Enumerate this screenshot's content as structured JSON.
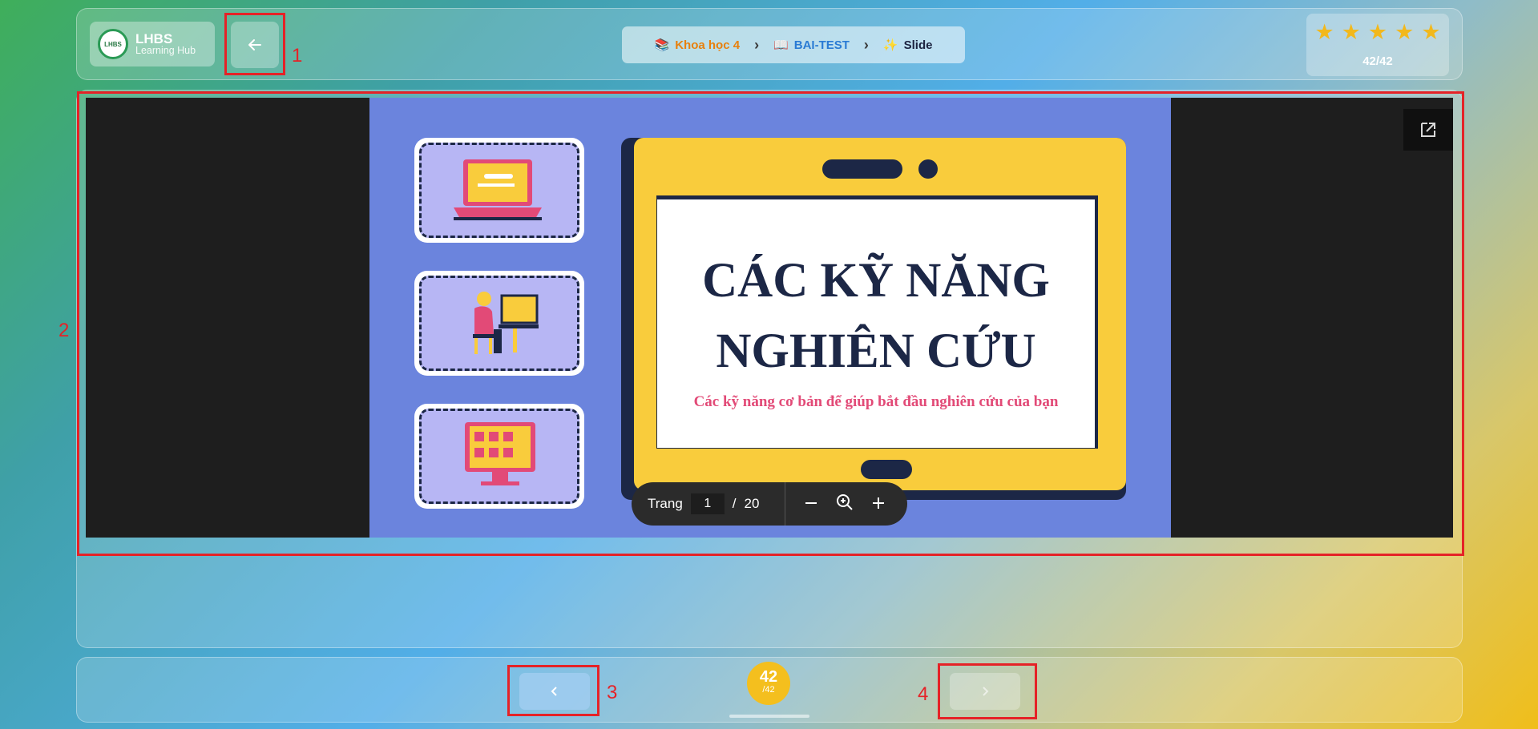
{
  "header": {
    "logo_title": "LHBS",
    "logo_subtitle": "Learning Hub",
    "logo_mark": "LHBS",
    "back_icon": "arrow-left-icon",
    "breadcrumb": [
      {
        "icon": "books-icon",
        "label": "Khoa học 4"
      },
      {
        "icon": "book-icon",
        "label": "BAI-TEST"
      },
      {
        "icon": "sparkles-icon",
        "label": "Slide"
      }
    ],
    "stars": 5,
    "progress": "42/42"
  },
  "viewer": {
    "slide_title_line1": "CÁC KỸ NĂNG",
    "slide_title_line2": "NGHIÊN CỨU",
    "slide_subtitle": "Các kỹ năng cơ bản để giúp bắt đầu nghiên cứu của bạn",
    "toolbar": {
      "page_label": "Trang",
      "page_value": "1",
      "page_separator": "/",
      "page_total": "20"
    },
    "popout_icon": "external-link-icon"
  },
  "footer": {
    "prev_icon": "chevron-left-icon",
    "next_icon": "chevron-right-icon",
    "counter_current": "42",
    "counter_total": "/42"
  },
  "annotations": [
    "1",
    "2",
    "3",
    "4"
  ],
  "colors": {
    "accent_orange": "#e8800c",
    "accent_blue": "#2a7bd4",
    "star": "#f2b81c",
    "annotation_red": "#e52227",
    "slide_navy": "#1c2746",
    "slide_pink": "#e24a77",
    "slide_yellow": "#f9cc3c",
    "slide_bg": "#6b84dd"
  }
}
